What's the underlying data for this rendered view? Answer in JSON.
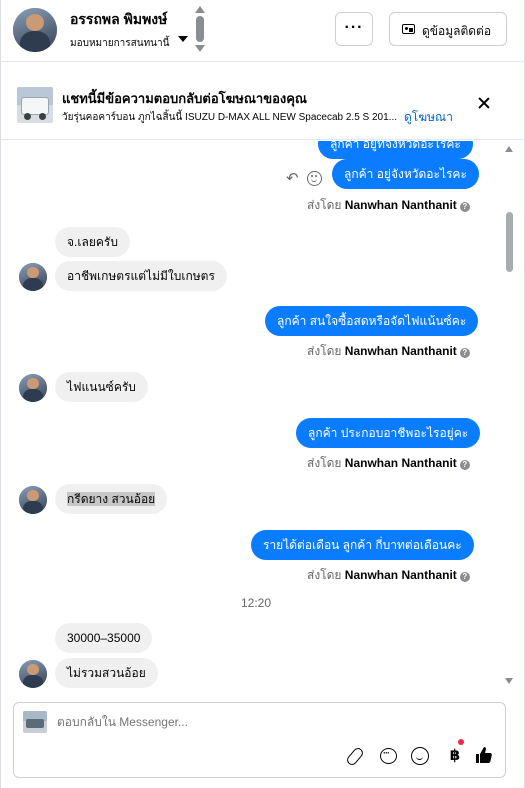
{
  "header": {
    "contact_name": "อรรถพล พิมพงษ์",
    "assign_label": "มอบหมายการสนทนานี้",
    "more_label": "···",
    "contact_info_label": "ดูข้อมูลติดต่อ"
  },
  "ad_banner": {
    "title": "แชทนี้มีข้อความตอบกลับต่อโฆษณาของคุณ",
    "subtitle": "วัยรุ่นคอคาร์บอน ภูกไฉสิ้นนี้ ISUZU D-MAX ALL NEW Spacecab 2.5 S 201...",
    "view_ad_link": "ดูโฆษณา"
  },
  "messages": {
    "m1_partial": "ลูกค้า อยู่ที่จังหวัดอะไรคะ",
    "m2": "ลูกค้า อยู่จังหวัดอะไรคะ",
    "sent_by_prefix": "ส่งโดย",
    "agent_name": "Nanwhan Nanthanit",
    "m3": "จ.เลยครับ",
    "m4": "อาชีพเกษตรแต่ไม่มีใบเกษตร",
    "m5": "ลูกค้า สนใจซื้อสดหรือจัดไฟแน้นซ์คะ",
    "m6": "ไฟแนนซ์ครับ",
    "m7": "ลูกค้า ประกอบอาชีพอะไรอยู่คะ",
    "m8": "กรีดยาง สวนอ้อย",
    "m9": "รายได้ต่อเดือน  ลูกค้า กี่บาทต่อเดือนคะ",
    "timestamp": "12:20",
    "m10": "30000–35000",
    "m11": "ไม่รวมสวนอ้อย"
  },
  "composer": {
    "placeholder": "ตอบกลับใน Messenger...",
    "baht_symbol": "฿"
  },
  "colors": {
    "outgoing_bubble": "#0a7cff",
    "incoming_bubble": "#f0f0f0",
    "link": "#0064d1",
    "notification_dot": "#f02849"
  }
}
